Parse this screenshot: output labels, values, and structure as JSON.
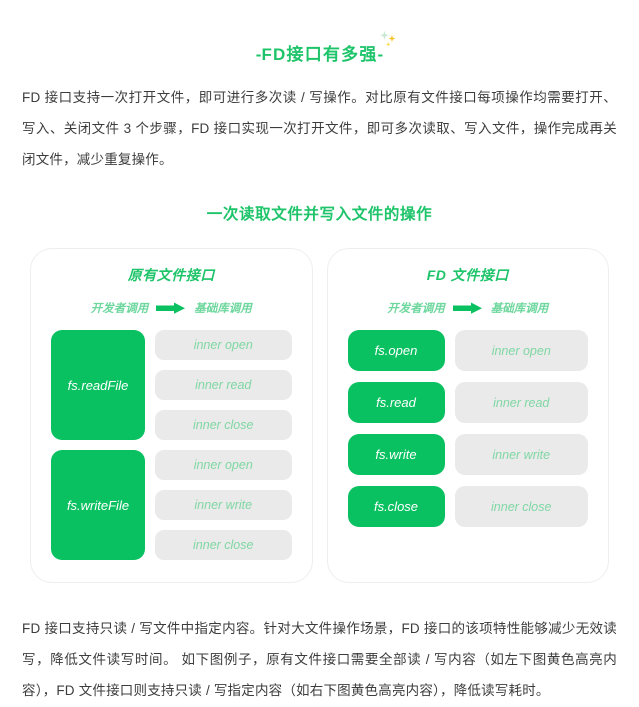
{
  "header": {
    "title_prefix": "-",
    "title": "FD接口有多强",
    "title_suffix": "-",
    "sparkle_icon": "sparkle-icon",
    "accent_color": "#1ec46a"
  },
  "intro_paragraph": "FD 接口支持一次打开文件，即可进行多次读 / 写操作。对比原有文件接口每项操作均需要打开、写入、关闭文件 3 个步骤，FD 接口实现一次打开文件，即可多次读取、写入文件，操作完成再关闭文件，减少重复操作。",
  "section_heading": "一次读取文件并写入文件的操作",
  "diagram": {
    "legend": {
      "left_label": "开发者调用",
      "arrow_icon": "arrow-right-icon",
      "right_label": "基础库调用"
    },
    "cards": [
      {
        "title": "原有文件接口",
        "layout": "grouped",
        "groups": [
          {
            "api": "fs.readFile",
            "inner_calls": [
              "inner open",
              "inner read",
              "inner close"
            ]
          },
          {
            "api": "fs.writeFile",
            "inner_calls": [
              "inner open",
              "inner write",
              "inner close"
            ]
          }
        ]
      },
      {
        "title": "FD 文件接口",
        "layout": "paired",
        "rows": [
          {
            "api": "fs.open",
            "inner_call": "inner open"
          },
          {
            "api": "fs.read",
            "inner_call": "inner read"
          },
          {
            "api": "fs.write",
            "inner_call": "inner write"
          },
          {
            "api": "fs.close",
            "inner_call": "inner close"
          }
        ]
      }
    ],
    "colors": {
      "green_block": "#0ac161",
      "gray_block": "#eaeaea",
      "gray_block_text": "#7fd7a4",
      "card_border": "#eeeeee"
    }
  },
  "outro_paragraph": "FD 接口支持只读 / 写文件中指定内容。针对大文件操作场景，FD 接口的该项特性能够减少无效读写，降低文件读写时间。 如下图例子，原有文件接口需要全部读 / 写内容（如左下图黄色高亮内容），FD 文件接口则支持只读 / 写指定内容（如右下图黄色高亮内容），降低读写耗时。"
}
